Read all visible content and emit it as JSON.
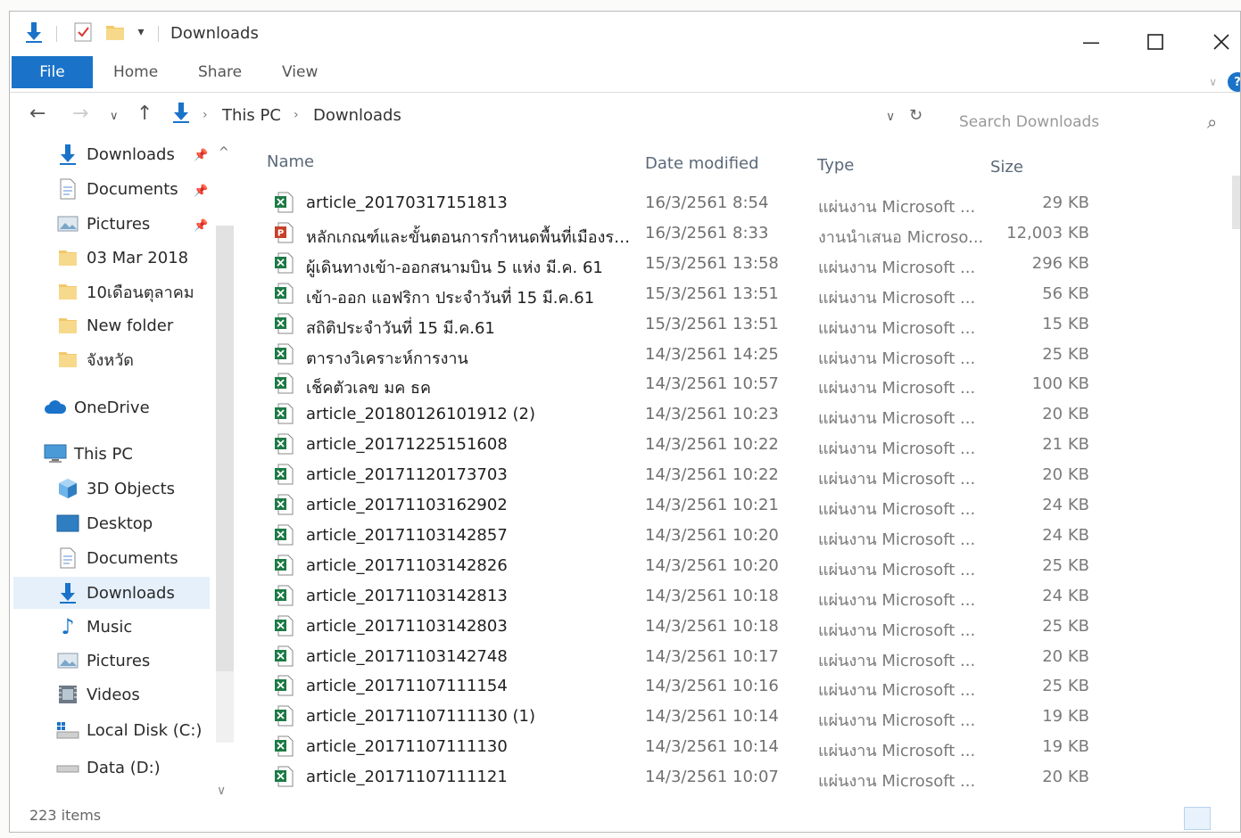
{
  "window": {
    "title": "Downloads"
  },
  "ribbon": {
    "file": "File",
    "tabs": [
      "Home",
      "Share",
      "View"
    ]
  },
  "address": {
    "crumbs": [
      "This PC",
      "Downloads"
    ],
    "search_placeholder": "Search Downloads"
  },
  "nav": {
    "quick_access": [
      {
        "label": "Downloads",
        "icon": "download-arrow-icon",
        "pinned": true
      },
      {
        "label": "Documents",
        "icon": "document-icon",
        "pinned": true
      },
      {
        "label": "Pictures",
        "icon": "pictures-icon",
        "pinned": true
      },
      {
        "label": "03 Mar 2018",
        "icon": "folder-icon",
        "pinned": false
      },
      {
        "label": "10เดือนตุลาคม",
        "icon": "folder-icon",
        "pinned": false
      },
      {
        "label": "New folder",
        "icon": "folder-icon",
        "pinned": false
      },
      {
        "label": "จังหวัด",
        "icon": "folder-icon",
        "pinned": false
      }
    ],
    "onedrive": "OneDrive",
    "this_pc": "This PC",
    "this_pc_items": [
      {
        "label": "3D Objects",
        "icon": "cube-icon"
      },
      {
        "label": "Desktop",
        "icon": "desktop-icon"
      },
      {
        "label": "Documents",
        "icon": "document-icon"
      },
      {
        "label": "Downloads",
        "icon": "download-arrow-icon",
        "selected": true
      },
      {
        "label": "Music",
        "icon": "music-note-icon"
      },
      {
        "label": "Pictures",
        "icon": "pictures-icon"
      },
      {
        "label": "Videos",
        "icon": "video-icon"
      },
      {
        "label": "Local Disk (C:)",
        "icon": "drive-windows-icon"
      },
      {
        "label": "Data (D:)",
        "icon": "drive-icon"
      }
    ]
  },
  "columns": {
    "name": "Name",
    "date": "Date modified",
    "type": "Type",
    "size": "Size"
  },
  "files": [
    {
      "name": "article_20170317151813",
      "date": "16/3/2561 8:54",
      "type": "แผ่นงาน Microsoft ...",
      "size": "29 KB",
      "kind": "excel"
    },
    {
      "name": "หลักเกณฑ์และขั้นตอนการกำหนดพื้นที่เมืองรองเ...",
      "date": "16/3/2561 8:33",
      "type": "งานนำเสนอ Microso...",
      "size": "12,003 KB",
      "kind": "powerpoint"
    },
    {
      "name": "ผู้เดินทางเข้า-ออกสนามบิน 5 แห่ง มี.ค. 61",
      "date": "15/3/2561 13:58",
      "type": "แผ่นงาน Microsoft ...",
      "size": "296 KB",
      "kind": "excel"
    },
    {
      "name": "เข้า-ออก แอฟริกา ประจำวันที่ 15 มี.ค.61",
      "date": "15/3/2561 13:51",
      "type": "แผ่นงาน Microsoft ...",
      "size": "56 KB",
      "kind": "excel"
    },
    {
      "name": "สถิติประจำวันที่ 15 มี.ค.61",
      "date": "15/3/2561 13:51",
      "type": "แผ่นงาน Microsoft ...",
      "size": "15 KB",
      "kind": "excel"
    },
    {
      "name": "ตารางวิเคราะห์การงาน",
      "date": "14/3/2561 14:25",
      "type": "แผ่นงาน Microsoft ...",
      "size": "25 KB",
      "kind": "excel"
    },
    {
      "name": "เช็คตัวเลข มค ธค",
      "date": "14/3/2561 10:57",
      "type": "แผ่นงาน Microsoft ...",
      "size": "100 KB",
      "kind": "excel"
    },
    {
      "name": "article_20180126101912 (2)",
      "date": "14/3/2561 10:23",
      "type": "แผ่นงาน Microsoft ...",
      "size": "20 KB",
      "kind": "excel"
    },
    {
      "name": "article_20171225151608",
      "date": "14/3/2561 10:22",
      "type": "แผ่นงาน Microsoft ...",
      "size": "21 KB",
      "kind": "excel"
    },
    {
      "name": "article_20171120173703",
      "date": "14/3/2561 10:22",
      "type": "แผ่นงาน Microsoft ...",
      "size": "20 KB",
      "kind": "excel"
    },
    {
      "name": "article_20171103162902",
      "date": "14/3/2561 10:21",
      "type": "แผ่นงาน Microsoft ...",
      "size": "24 KB",
      "kind": "excel"
    },
    {
      "name": "article_20171103142857",
      "date": "14/3/2561 10:20",
      "type": "แผ่นงาน Microsoft ...",
      "size": "24 KB",
      "kind": "excel"
    },
    {
      "name": "article_20171103142826",
      "date": "14/3/2561 10:20",
      "type": "แผ่นงาน Microsoft ...",
      "size": "25 KB",
      "kind": "excel"
    },
    {
      "name": "article_20171103142813",
      "date": "14/3/2561 10:18",
      "type": "แผ่นงาน Microsoft ...",
      "size": "24 KB",
      "kind": "excel"
    },
    {
      "name": "article_20171103142803",
      "date": "14/3/2561 10:18",
      "type": "แผ่นงาน Microsoft ...",
      "size": "25 KB",
      "kind": "excel"
    },
    {
      "name": "article_20171103142748",
      "date": "14/3/2561 10:17",
      "type": "แผ่นงาน Microsoft ...",
      "size": "20 KB",
      "kind": "excel"
    },
    {
      "name": "article_20171107111154",
      "date": "14/3/2561 10:16",
      "type": "แผ่นงาน Microsoft ...",
      "size": "25 KB",
      "kind": "excel"
    },
    {
      "name": "article_20171107111130 (1)",
      "date": "14/3/2561 10:14",
      "type": "แผ่นงาน Microsoft ...",
      "size": "19 KB",
      "kind": "excel"
    },
    {
      "name": "article_20171107111130",
      "date": "14/3/2561 10:14",
      "type": "แผ่นงาน Microsoft ...",
      "size": "19 KB",
      "kind": "excel"
    },
    {
      "name": "article_20171107111121",
      "date": "14/3/2561 10:07",
      "type": "แผ่นงาน Microsoft ...",
      "size": "20 KB",
      "kind": "excel"
    }
  ],
  "status": {
    "items": "223 items"
  },
  "colors": {
    "accent": "#1a73c9",
    "selected_bg": "#e5f0fb",
    "excel_green": "#1d7a45",
    "ppt_red": "#c8412a"
  }
}
